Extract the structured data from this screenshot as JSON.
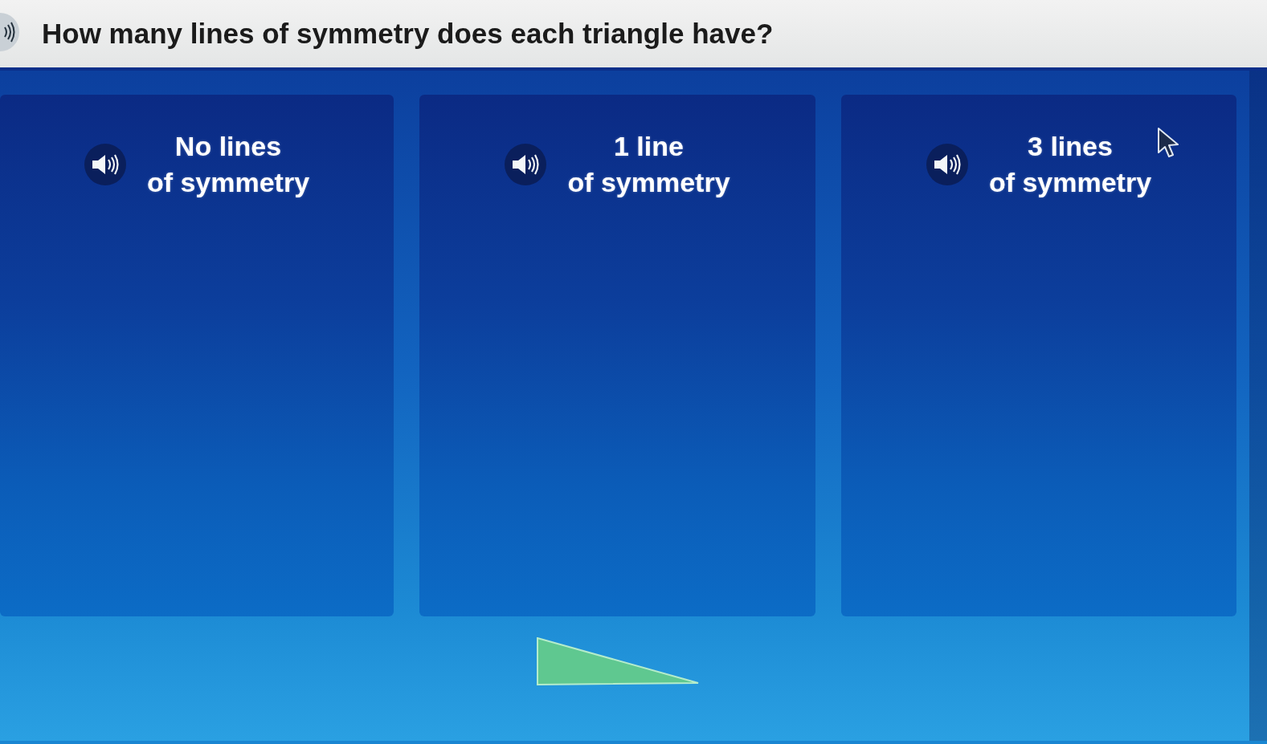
{
  "question": {
    "text": "How many lines of symmetry does each triangle have?"
  },
  "zones": [
    {
      "label_lines": [
        "No lines",
        "of symmetry"
      ]
    },
    {
      "label_lines": [
        "1 line",
        "of symmetry"
      ]
    },
    {
      "label_lines": [
        "3 lines",
        "of symmetry"
      ]
    }
  ],
  "tray": {
    "shapes": [
      {
        "kind": "right-triangle"
      }
    ]
  }
}
